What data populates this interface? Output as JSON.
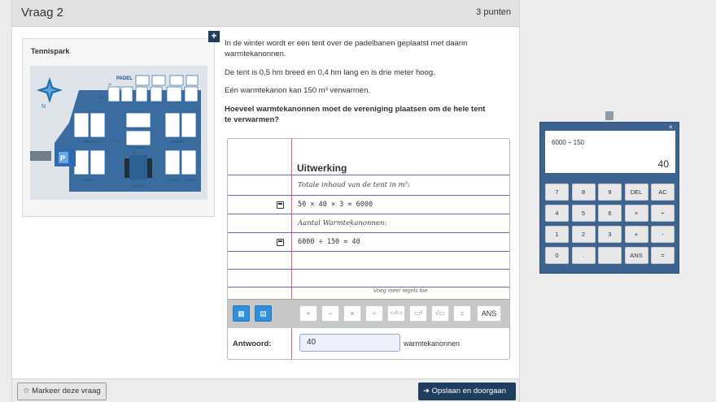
{
  "header": {
    "title": "Vraag 2",
    "points": "3 punten"
  },
  "map": {
    "title": "Tennispark",
    "padel_label": "PADEL",
    "parking": "P",
    "small_labels": [
      "10",
      "20",
      "13",
      "25",
      "SPARKSPEL",
      "CLUBHUIS",
      "VERKEER",
      "DOELEN",
      "KANTINE",
      "ZONE 3",
      "DOELEN"
    ]
  },
  "question": {
    "p1": "In de winter wordt er een tent over de padelbanen geplaatst met daarin warmtekanonnen.",
    "p2": "De tent is 0,5 hm breed en 0,4 hm lang en is drie meter hoog.",
    "p3": "Eén warmtekanon kan 150 m³ verwarmen.",
    "p4": "Hoeveel warmtekanonnen moet de vereniging plaatsen om de hele tent te verwarmen?"
  },
  "worksheet": {
    "heading": "Uitwerking",
    "rows": [
      {
        "text": "Totale inhoud van de tent in m³:"
      },
      {
        "text": "50 × 40 × 3 = 6000"
      },
      {
        "text": "Aantal Warmtekanonnen:"
      },
      {
        "text": "6000 ÷ 150 = 40"
      }
    ],
    "more_rows": "Voeg meer regels toe",
    "math_buttons": [
      "+",
      "−",
      "×",
      "÷",
      "▭/▭",
      "▭²",
      "√▭",
      "=",
      "ANS"
    ]
  },
  "answer": {
    "label": "Antwoord:",
    "value": "40",
    "unit": "warmtekanonnen"
  },
  "footer": {
    "mark_label": "Markeer deze vraag",
    "save_label": "Opslaan en doorgaan"
  },
  "calculator": {
    "expression": "6000 ÷ 150",
    "result": "40",
    "close": "×",
    "keys": [
      "7",
      "8",
      "9",
      "DEL",
      "AC",
      "4",
      "5",
      "6",
      "×",
      "÷",
      "1",
      "2",
      "3",
      "+",
      "-",
      "0",
      ".",
      "",
      "ANS",
      "="
    ]
  },
  "colors": {
    "navy": "#1f3d5c",
    "calc_blue": "#3d6391",
    "red_margin": "#d9606a",
    "ruled_line": "#6f66b8",
    "toolbar_blue": "#2f8fdc"
  }
}
